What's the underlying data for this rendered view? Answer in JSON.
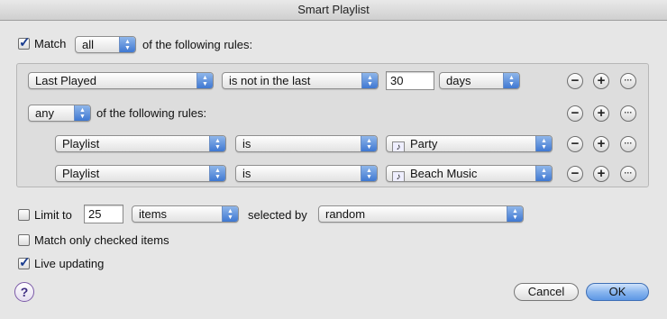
{
  "window": {
    "title": "Smart Playlist"
  },
  "match": {
    "checked": true,
    "label": "Match",
    "mode": "all",
    "suffix": "of the following rules:"
  },
  "rules": [
    {
      "field": "Last Played",
      "operator": "is not in the last",
      "value": "30",
      "unit": "days"
    },
    {
      "nested_mode": "any",
      "nested_suffix": "of the following rules:"
    },
    {
      "field": "Playlist",
      "operator": "is",
      "value": "Party"
    },
    {
      "field": "Playlist",
      "operator": "is",
      "value": "Beach Music"
    }
  ],
  "rule_buttons": {
    "remove": "−",
    "add": "+",
    "more": "···"
  },
  "limit": {
    "checked": false,
    "label": "Limit to",
    "value": "25",
    "unit": "items",
    "selected_by_label": "selected by",
    "selected_by": "random"
  },
  "match_only_checked": {
    "checked": false,
    "label": "Match only checked items"
  },
  "live_updating": {
    "checked": true,
    "label": "Live updating"
  },
  "buttons": {
    "help": "?",
    "cancel": "Cancel",
    "ok": "OK"
  },
  "colors": {
    "accent": "#3f78d2",
    "default_button": "#5d97e6",
    "background": "#e6e6e6"
  }
}
